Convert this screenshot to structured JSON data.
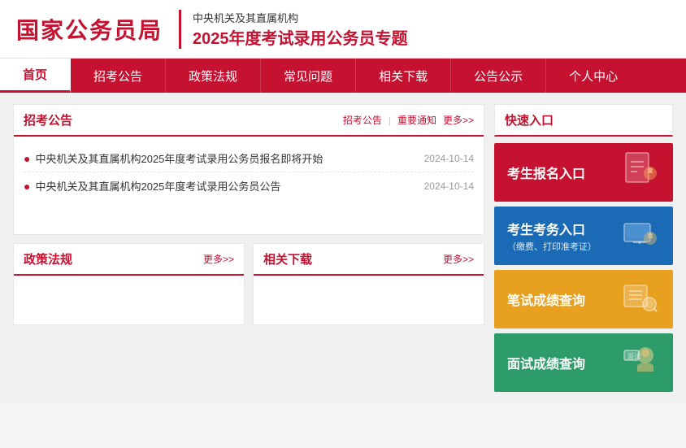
{
  "header": {
    "logo": "国家公务员局",
    "subtitle_top": "中央机关及其直属机构",
    "subtitle_bottom": "2025年度考试录用公务员专题"
  },
  "nav": {
    "items": [
      {
        "label": "首页",
        "active": true
      },
      {
        "label": "招考公告",
        "active": false
      },
      {
        "label": "政策法规",
        "active": false
      },
      {
        "label": "常见问题",
        "active": false
      },
      {
        "label": "相关下载",
        "active": false
      },
      {
        "label": "公告公示",
        "active": false
      },
      {
        "label": "个人中心",
        "active": false
      }
    ]
  },
  "announcement_panel": {
    "title": "招考公告",
    "filter_links": [
      "招考公告",
      "重要通知"
    ],
    "more_label": "更多>>",
    "news": [
      {
        "title": "中央机关及其直属机构2025年度考试录用公务员报名即将开始",
        "date": "2024-10-14"
      },
      {
        "title": "中央机关及其直属机构2025年度考试录用公务员公告",
        "date": "2024-10-14"
      }
    ]
  },
  "policy_panel": {
    "title": "政策法规",
    "more_label": "更多>>"
  },
  "related_panel": {
    "title": "相关下载",
    "more_label": "更多>>"
  },
  "quick_access": {
    "title": "快速入口",
    "buttons": [
      {
        "label": "考生报名入口",
        "sublabel": "",
        "color": "red",
        "icon": "📋"
      },
      {
        "label": "考生考务入口",
        "sublabel": "（缴费、打印准考证）",
        "color": "blue",
        "icon": "💻"
      },
      {
        "label": "笔试成绩查询",
        "sublabel": "",
        "color": "orange",
        "icon": "🔍"
      },
      {
        "label": "面试成绩查询",
        "sublabel": "",
        "color": "green",
        "icon": "👤"
      }
    ]
  }
}
